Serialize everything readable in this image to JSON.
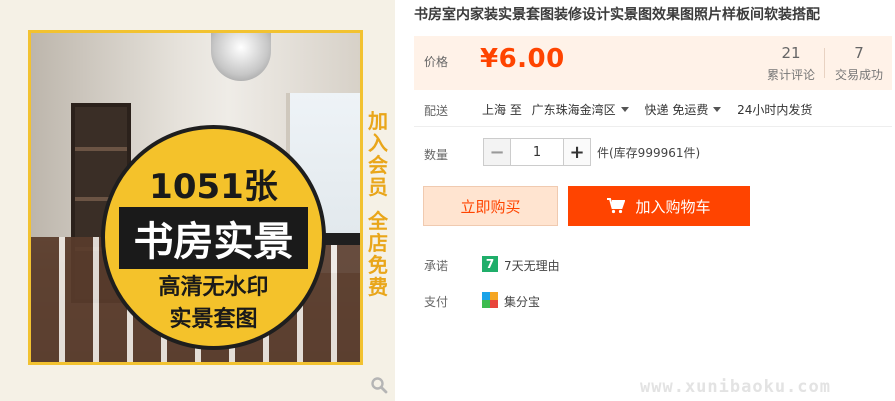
{
  "product": {
    "title": "书房室内家装实景套图装修设计实景图效果图照片样板间软装搭配"
  },
  "image": {
    "badge": {
      "line1": "1051张",
      "line2": "书房实景",
      "line3": "高清无水印",
      "line4": "实景套图"
    },
    "side_promo_top": "加入会员",
    "side_promo_bottom": "全店免费"
  },
  "price": {
    "label": "价格",
    "value": "¥6.00"
  },
  "stats": {
    "reviews_count": "21",
    "reviews_label": "累计评论",
    "sales_count": "7",
    "sales_label": "交易成功"
  },
  "shipping": {
    "label": "配送",
    "from": "上海 至",
    "to": "广东珠海金湾区",
    "method": "快递 免运费",
    "dispatch": "24小时内发货"
  },
  "quantity": {
    "label": "数量",
    "value": "1",
    "minus": "−",
    "plus": "+",
    "stock": "件(库存999961件)"
  },
  "actions": {
    "buy_now": "立即购买",
    "add_to_cart": "加入购物车"
  },
  "promise": {
    "label": "承诺",
    "icon_text": "7",
    "text": "7天无理由"
  },
  "payment": {
    "label": "支付",
    "text": "集分宝"
  },
  "watermark": "www.xunibaoku.com",
  "colors": {
    "accent": "#ff4400",
    "badge": "#f4c22b",
    "promise": "#1fae6a"
  }
}
